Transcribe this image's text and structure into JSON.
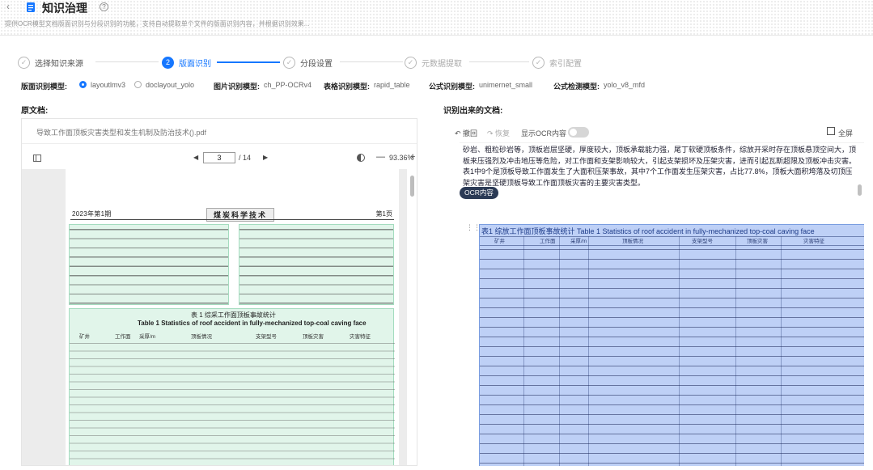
{
  "header": {
    "title": "知识治理",
    "description": "提供OCR模型文档版面识别与分段识别的功能，支持自动提取单个文件的版面识别内容，并根据识别效果..."
  },
  "steps": [
    {
      "num": "1",
      "label": "选择知识来源",
      "state": "done"
    },
    {
      "num": "2",
      "label": "版面识别",
      "state": "active"
    },
    {
      "num": "3",
      "label": "分段设置",
      "state": "todo"
    },
    {
      "num": "4",
      "label": "元数据提取",
      "state": "todo"
    },
    {
      "num": "5",
      "label": "索引配置",
      "state": "todo"
    }
  ],
  "models": {
    "layout_label": "版面识别模型:",
    "layout_opt1": "layoutlmv3",
    "layout_opt2": "doclayout_yolo",
    "image_label": "图片识别模型:",
    "image_value": "ch_PP-OCRv4",
    "table_label": "表格识别模型:",
    "table_value": "rapid_table",
    "formula_label": "公式识别模型:",
    "formula_value": "unimernet_small",
    "detect_label": "公式检测模型:",
    "detect_value": "yolo_v8_mfd"
  },
  "left": {
    "section_label": "原文档:",
    "file_name": "导致工作面顶板灾害类型和发生机制及防治技术().pdf",
    "page_current": "3",
    "page_total": "/ 14",
    "zoom": "93.36%",
    "paper": {
      "header_left": "2023年第1期",
      "header_center": "煤炭科学技术",
      "header_right": "第1页",
      "table_caption_cn": "表 1  综采工作面顶板事故统计",
      "table_caption_en": "Table 1  Statistics of roof accident in fully-mechanized top-coal caving face",
      "table_headers": [
        "矿井",
        "工作面",
        "采厚/m",
        "顶板情况",
        "支架型号",
        "顶板灾害",
        "灾害特征"
      ]
    }
  },
  "right": {
    "section_label": "识别出来的文档:",
    "undo": "撤回",
    "redo": "恢复",
    "ocr_toggle": "显示OCR内容",
    "fullscreen": "全屏",
    "paragraph": "砂岩、粗粒砂岩等，顶板岩层坚硬，厚度较大，顶板承载能力强，尾丁软硬顶板条件，综放开采时存在顶板悬顶空间大，顶板来压强烈及冲击地压等危险，对工作面和支架影响较大，引起支架损坏及压架灾害，进而引起瓦斯超限及顶板冲击灾害。表1中9个是顶板导致工作面发生了大面积压架事故，其中7个工作面发生压架灾害，占比77.8%，顶板大面积垮落及切顶压架灾害是坚硬顶板导致工作面顶板灾害的主要灾害类型。",
    "ocr_chip": "OCR内容",
    "table_caption": "表1 综放工作面顶板事故统计 Table 1 Statistics of roof accident in fully-mechanized top-coal caving face",
    "table_headers": [
      "矿井",
      "工作面",
      "采厚/m",
      "顶板情况",
      "支架型号",
      "顶板灾害",
      "灾害特征"
    ]
  }
}
